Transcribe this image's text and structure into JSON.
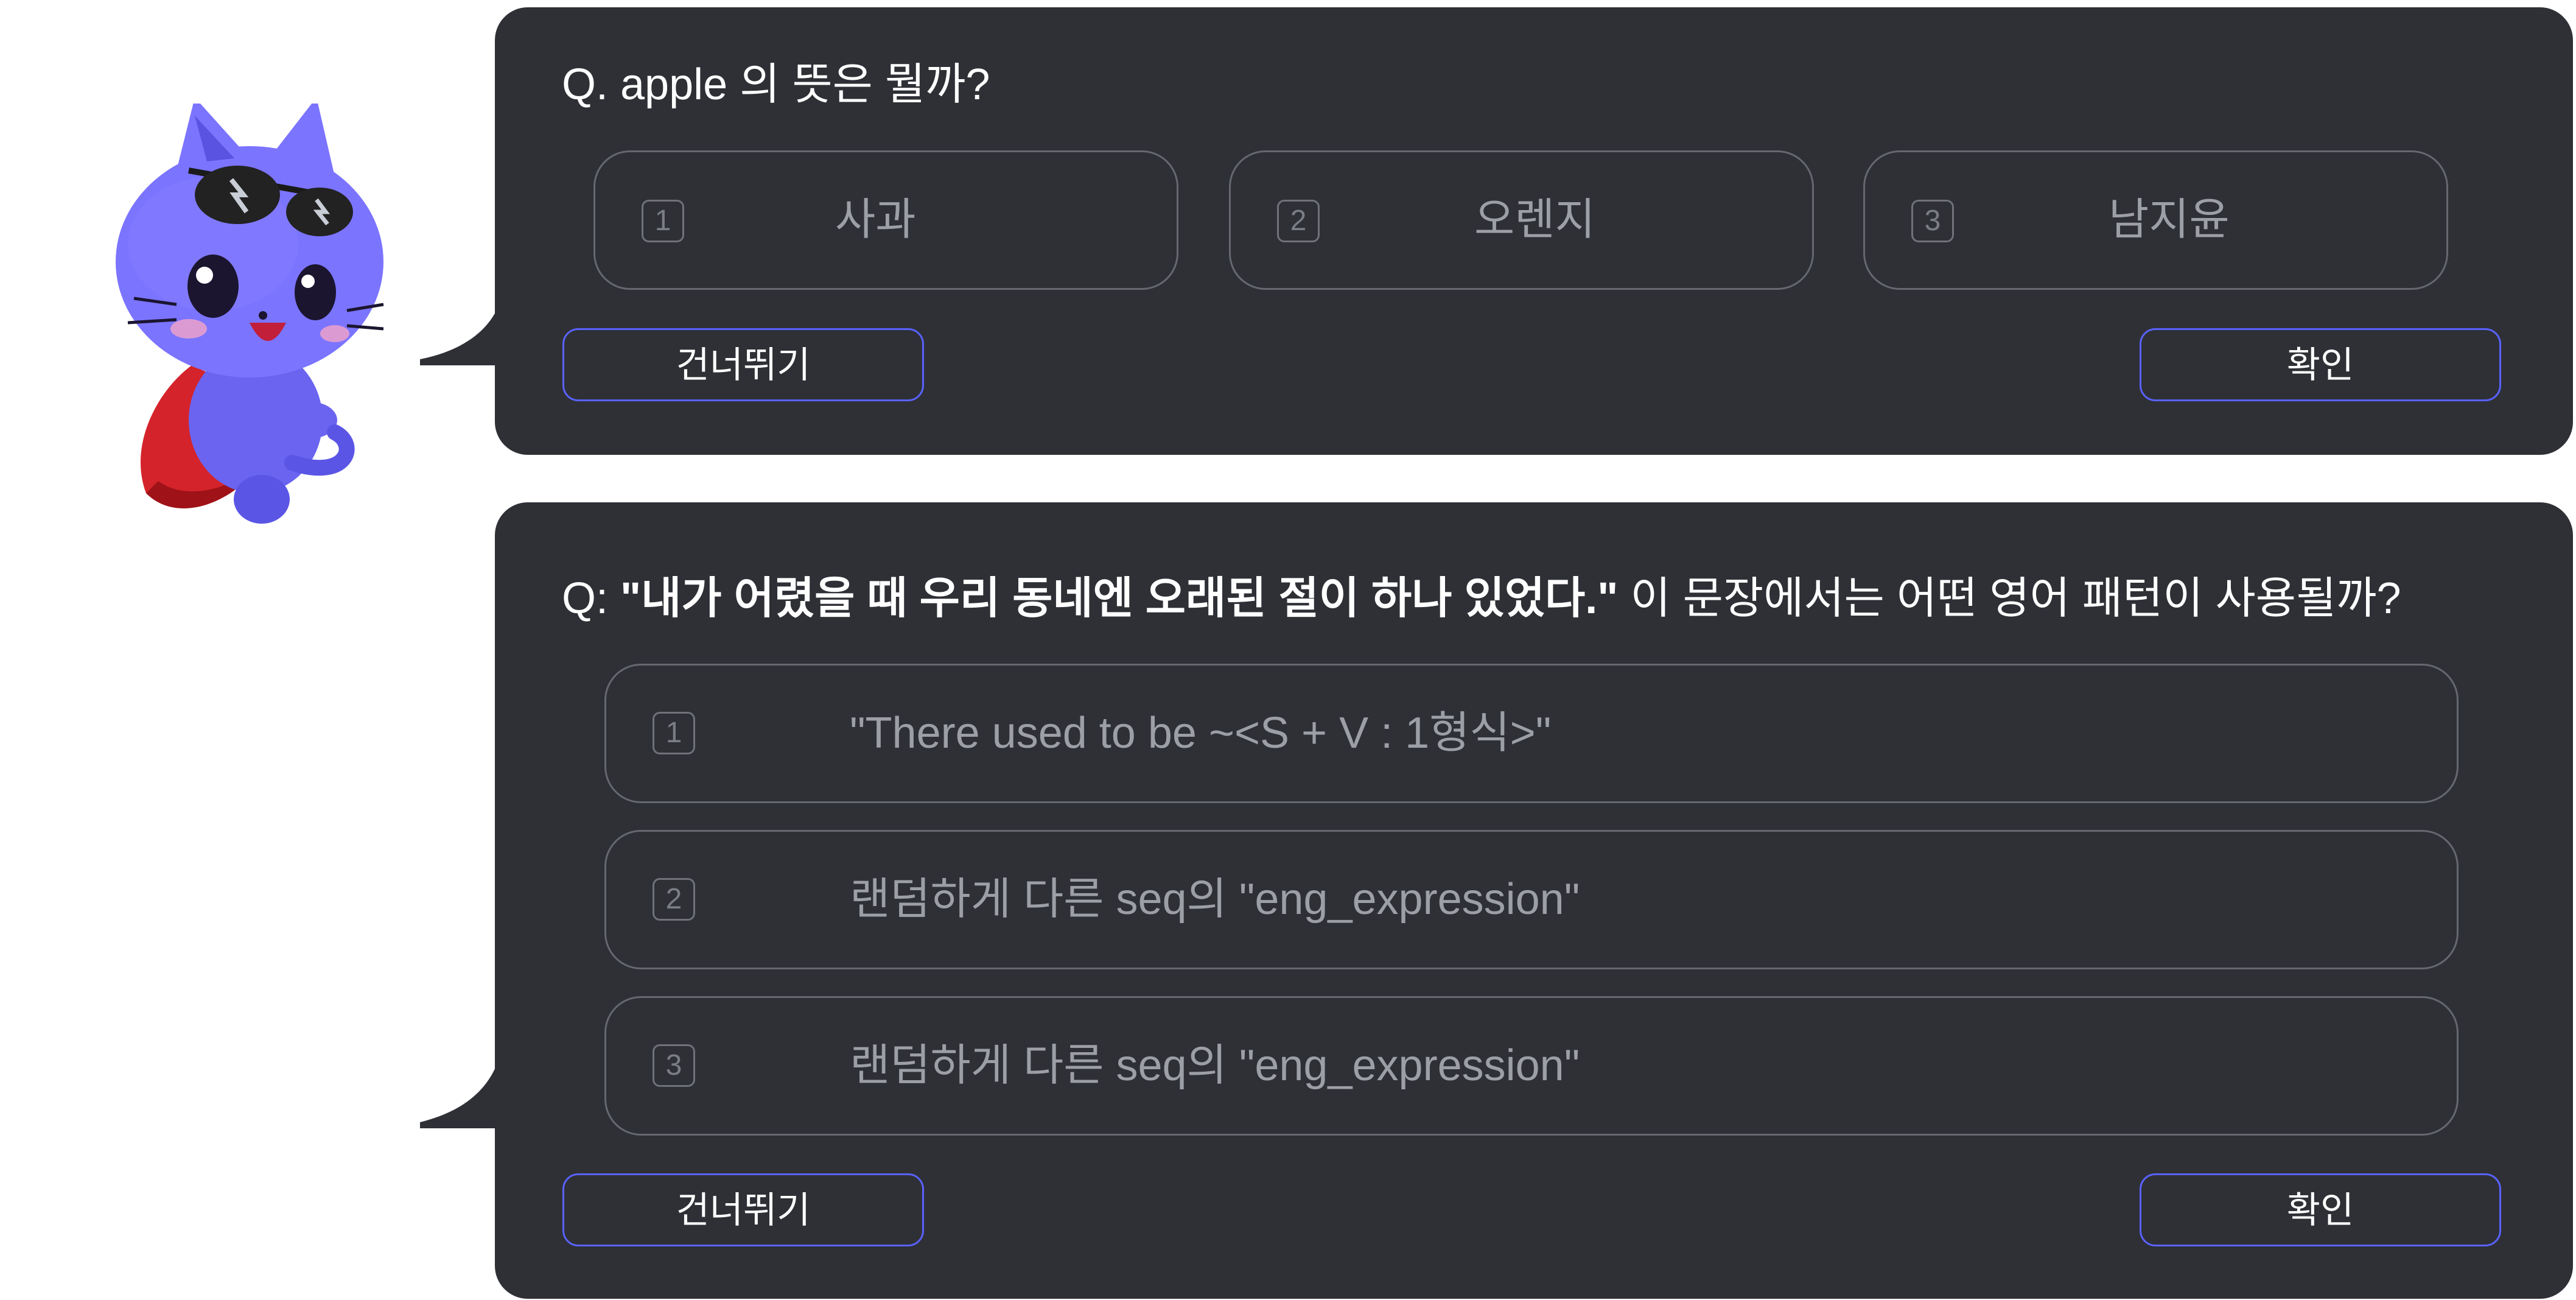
{
  "quiz1": {
    "question": "Q. apple 의 뜻은 뭘까?",
    "options": [
      {
        "number": "1",
        "label": "사과"
      },
      {
        "number": "2",
        "label": "오렌지"
      },
      {
        "number": "3",
        "label": "남지윤"
      }
    ],
    "skip_label": "건너뛰기",
    "confirm_label": "확인"
  },
  "quiz2": {
    "question_prefix": "Q: ",
    "question_quote": "\"내가 어렸을 때 우리 동네엔 오래된 절이 하나 있었다.\"",
    "question_suffix": " 이 문장에서는 어떤 영어 패턴이 사용될까?",
    "options": [
      {
        "number": "1",
        "label": "\"There used to be ~<S + V : 1형식>\""
      },
      {
        "number": "2",
        "label": "랜덤하게 다른 seq의 \"eng_expression\""
      },
      {
        "number": "3",
        "label": "랜덤하게 다른 seq의 \"eng_expression\""
      }
    ],
    "skip_label": "건너뛰기",
    "confirm_label": "확인"
  },
  "colors": {
    "panel_bg": "#2e3036",
    "button_border": "#5a62ff",
    "option_border": "#65686f",
    "option_text": "#9c9fa5",
    "mascot_body": "#6f6cf5",
    "mascot_cape": "#d4232a"
  },
  "icons": {
    "mascot": "blue-cat-mascot-with-sunglasses-and-cape"
  }
}
